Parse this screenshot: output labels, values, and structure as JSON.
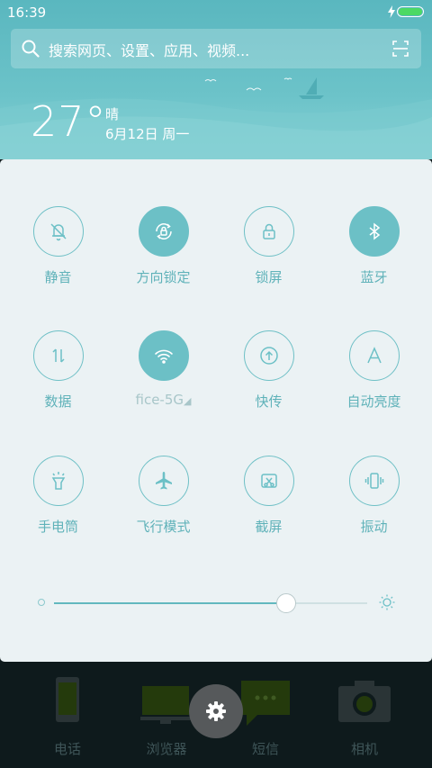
{
  "status_bar": {
    "time": "16:39",
    "battery_color": "#4cd964"
  },
  "search": {
    "placeholder": "搜索网页、设置、应用、视频..."
  },
  "weather": {
    "temperature": "27°",
    "condition": "晴",
    "date": "6月12日 周一"
  },
  "quick_settings": [
    {
      "label": "静音",
      "icon": "bell-off-icon",
      "active": false
    },
    {
      "label": "方向锁定",
      "icon": "rotation-lock-icon",
      "active": true
    },
    {
      "label": "锁屏",
      "icon": "lock-icon",
      "active": false
    },
    {
      "label": "蓝牙",
      "icon": "bluetooth-icon",
      "active": true
    },
    {
      "label": "数据",
      "icon": "mobile-data-icon",
      "active": false
    },
    {
      "label": "fice-5G",
      "icon": "wifi-icon",
      "active": true
    },
    {
      "label": "快传",
      "icon": "quick-transfer-icon",
      "active": false
    },
    {
      "label": "自动亮度",
      "icon": "auto-brightness-icon",
      "active": false
    },
    {
      "label": "手电筒",
      "icon": "flashlight-icon",
      "active": false
    },
    {
      "label": "飞行模式",
      "icon": "airplane-icon",
      "active": false
    },
    {
      "label": "截屏",
      "icon": "screenshot-icon",
      "active": false
    },
    {
      "label": "振动",
      "icon": "vibrate-icon",
      "active": false
    }
  ],
  "brightness": {
    "level": 0.74
  },
  "dock": [
    {
      "label": "电话",
      "icon": "phone-icon"
    },
    {
      "label": "浏览器",
      "icon": "browser-icon"
    },
    {
      "label": "短信",
      "icon": "messages-icon"
    },
    {
      "label": "相机",
      "icon": "camera-icon"
    }
  ],
  "accent_color": "#6cc0c6"
}
